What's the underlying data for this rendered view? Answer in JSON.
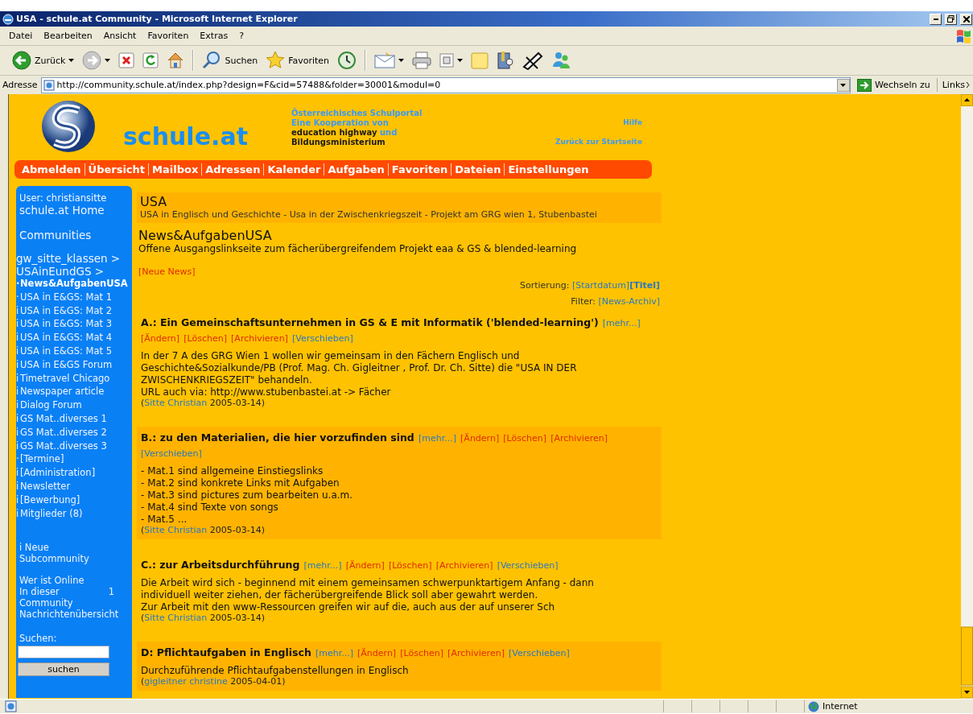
{
  "window": {
    "title": "USA - schule.at Community - Microsoft Internet Explorer"
  },
  "menu": [
    "Datei",
    "Bearbeiten",
    "Ansicht",
    "Favoriten",
    "Extras",
    "?"
  ],
  "toolbar": [
    {
      "kind": "back",
      "label": "Zurück",
      "dropdown": true
    },
    {
      "kind": "forward",
      "dropdown": true
    },
    {
      "kind": "stop",
      "dropdown": false
    },
    {
      "kind": "refresh",
      "dropdown": false
    },
    {
      "kind": "home",
      "dropdown": false
    },
    {
      "kind": "separator"
    },
    {
      "kind": "search",
      "label": "Suchen",
      "dropdown": false
    },
    {
      "kind": "favorites",
      "label": "Favoriten",
      "dropdown": false
    },
    {
      "kind": "history",
      "dropdown": false
    },
    {
      "kind": "separator"
    },
    {
      "kind": "mail",
      "dropdown": true
    },
    {
      "kind": "print",
      "dropdown": false
    },
    {
      "kind": "edit",
      "dropdown": true
    },
    {
      "kind": "note",
      "dropdown": false
    },
    {
      "kind": "research",
      "dropdown": false
    },
    {
      "kind": "tool",
      "dropdown": false
    },
    {
      "kind": "messenger",
      "dropdown": false
    }
  ],
  "address": {
    "label": "Adresse",
    "url": "http://community.schule.at/index.php?design=F&cid=57488&folder=30001&modul=0",
    "go": "Wechseln zu",
    "links": "Links"
  },
  "site": {
    "name": "schule.at",
    "tagline": [
      [
        {
          "text": "Österreichisches Schulportal",
          "color": "#3a9af8"
        }
      ],
      [
        {
          "text": "Eine  Kooperation von",
          "color": "#3a9af8"
        }
      ],
      [
        {
          "text": "education highway",
          "color": "#1a1a1a"
        },
        {
          "text": " und",
          "color": "#3a9af8"
        }
      ],
      [
        {
          "text": "Bildungsministerium",
          "color": "#1a1a1a"
        }
      ]
    ],
    "help": "Hilfe",
    "start": "Zurück zur Startseite",
    "nav": [
      "Abmelden",
      "Übersicht",
      "Mailbox",
      "Adressen",
      "Kalender",
      "Aufgaben",
      "Favoriten",
      "Dateien",
      "Einstellungen"
    ]
  },
  "sidebar": {
    "user": "User: christiansitte",
    "home": "schule.at Home",
    "communities": "Communities",
    "path": [
      "gw_sitte_klassen >",
      "USAinEundGS >"
    ],
    "items": [
      {
        "bullet": "·",
        "label": "News&AufgabenUSA",
        "selected": true
      },
      {
        "bullet": "·",
        "label": "USA in E&GS: Mat 1",
        "selected": false
      },
      {
        "bullet": "i",
        "label": "USA in E&GS: Mat 2",
        "selected": false
      },
      {
        "bullet": "i",
        "label": "USA in E&GS: Mat 3",
        "selected": false
      },
      {
        "bullet": "i",
        "label": "USA in E&GS: Mat 4",
        "selected": false
      },
      {
        "bullet": "i",
        "label": "USA in E&GS: Mat 5",
        "selected": false
      },
      {
        "bullet": "i",
        "label": "USA in E&GS Forum",
        "selected": false
      },
      {
        "bullet": "i",
        "label": "Timetravel Chicago",
        "selected": false
      },
      {
        "bullet": "i",
        "label": "Newspaper article",
        "selected": false
      },
      {
        "bullet": "i",
        "label": "Dialog Forum",
        "selected": false
      },
      {
        "bullet": "i",
        "label": "GS Mat..diverses 1",
        "selected": false
      },
      {
        "bullet": "i",
        "label": "GS Mat..diverses 2",
        "selected": false
      },
      {
        "bullet": "i",
        "label": "GS Mat..diverses 3",
        "selected": false
      },
      {
        "bullet": "·",
        "label": "[Termine]",
        "selected": false
      },
      {
        "bullet": "i",
        "label": "[Administration]",
        "selected": false
      },
      {
        "bullet": "i",
        "label": "Newsletter",
        "selected": false
      },
      {
        "bullet": "i",
        "label": "[Bewerbung]",
        "selected": false
      },
      {
        "bullet": "i",
        "label": "Mitglieder (8)",
        "selected": false
      }
    ],
    "new_subcommunity": "i Neue Subcommunity",
    "online_title": "Wer ist Online",
    "online_label": "In dieser Community",
    "online_count": "1",
    "messages": "Nachrichtenübersicht",
    "search_label": "Suchen:",
    "search_button": "suchen"
  },
  "content": {
    "title": "USA",
    "subtitle": "USA in Englisch und Geschichte - Usa in der Zwischenkriegszeit - Projekt am GRG wien 1, Stubenbastei",
    "section_title": "News&AufgabenUSA",
    "section_desc": "Offene Ausgangslinkseite zum fächerübergreifendem Projekt eaa & GS & blended-learning",
    "new_news": "[Neue News]",
    "sort": {
      "label": "Sortierung:",
      "options": [
        {
          "label": "[Startdatum]",
          "selected": false
        },
        {
          "label": "[Titel]",
          "selected": true
        }
      ]
    },
    "filter": {
      "label": "Filter:",
      "option": "[News-Archiv]"
    },
    "news": [
      {
        "title": "A.: Ein Gemeinschaftsunternehmen in GS & E mit Informatik ('blended-learning')",
        "highlighted": false,
        "actions": [
          {
            "label": "[mehr...]",
            "kind": "view"
          },
          {
            "label": "[Ändern]",
            "kind": "edit"
          },
          {
            "label": "[Löschen]",
            "kind": "delete"
          },
          {
            "label": "[Archivieren]",
            "kind": "archive"
          },
          {
            "label": "[Verschieben]",
            "kind": "move"
          }
        ],
        "body": [
          "In der 7 A des GRG Wien 1 wollen wir gemeinsam in den Fächern Englisch und Geschichte&Sozialkunde/PB (Prof. Mag. Ch. Gigleitner , Prof. Dr. Ch. Sitte) die \"USA IN DER ZWISCHENKRIEGSZEIT\" behandeln.",
          "URL auch via: http://www.stubenbastei.at -> Fächer"
        ],
        "byline_open": "(",
        "author": "Sitte Christian",
        "date": "2005-03-14)"
      },
      {
        "title": "B.: zu den Materialien, die hier vorzufinden sind",
        "highlighted": true,
        "actions": [
          {
            "label": "[mehr...]",
            "kind": "view"
          },
          {
            "label": "[Ändern]",
            "kind": "edit"
          },
          {
            "label": "[Löschen]",
            "kind": "delete"
          },
          {
            "label": "[Archivieren]",
            "kind": "archive"
          },
          {
            "label": "[Verschieben]",
            "kind": "move"
          }
        ],
        "body": [
          "- Mat.1 sind allgemeine Einstiegslinks",
          "- Mat.2 sind konkrete Links mit Aufgaben",
          "- Mat.3 sind pictures zum bearbeiten u.a.m.",
          "- Mat.4 sind Texte von songs",
          "- Mat.5 ..."
        ],
        "byline_open": "(",
        "author": "Sitte Christian",
        "date": "2005-03-14)"
      },
      {
        "title": "C.: zur Arbeitsdurchführung",
        "highlighted": false,
        "actions": [
          {
            "label": "[mehr...]",
            "kind": "view"
          },
          {
            "label": "[Ändern]",
            "kind": "edit"
          },
          {
            "label": "[Löschen]",
            "kind": "delete"
          },
          {
            "label": "[Archivieren]",
            "kind": "archive"
          },
          {
            "label": "[Verschieben]",
            "kind": "move"
          }
        ],
        "body": [
          "Die Arbeit wird sich - beginnend mit einem gemeinsamen schwerpunktartigem Anfang - dann individuell weiter ziehen, der fächerübergreifende Blick soll aber gewahrt werden.",
          "Zur Arbeit mit den www-Ressourcen greifen wir auf die, auch aus der auf unserer Sch"
        ],
        "byline_open": "(",
        "author": "Sitte Christian",
        "date": "2005-03-14)"
      },
      {
        "title": "D: Pflichtaufgaben in Englisch",
        "highlighted": true,
        "actions": [
          {
            "label": "[mehr...]",
            "kind": "view"
          },
          {
            "label": "[Ändern]",
            "kind": "edit"
          },
          {
            "label": "[Löschen]",
            "kind": "delete"
          },
          {
            "label": "[Archivieren]",
            "kind": "archive"
          },
          {
            "label": "[Verschieben]",
            "kind": "move"
          }
        ],
        "body": [
          "Durchzuführende Pflichtaufgabenstellungen in Englisch"
        ],
        "byline_open": "(",
        "author": "gigleitner christine",
        "date": "2005-04-01)"
      }
    ]
  },
  "status_bar": {
    "zone": "Internet"
  }
}
